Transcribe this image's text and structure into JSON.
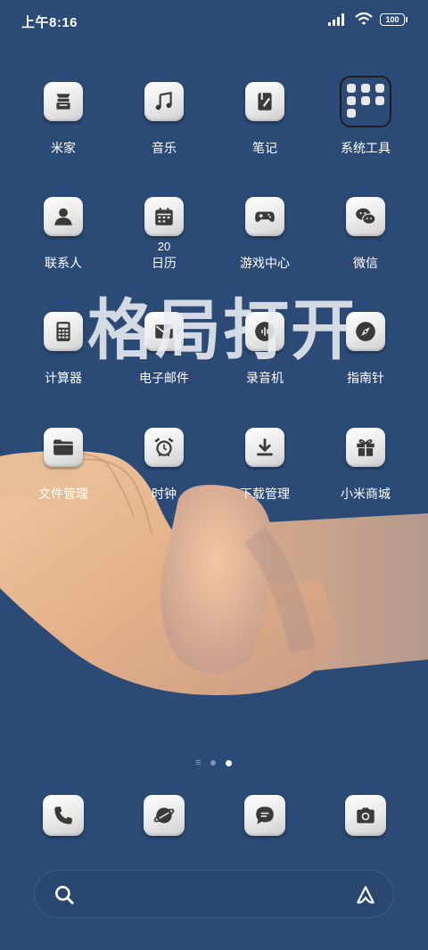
{
  "status_bar": {
    "time": "上午8:16",
    "battery": "100",
    "icons": [
      "signal-icon",
      "wifi-icon",
      "battery-icon"
    ]
  },
  "apps": [
    {
      "label": "米家",
      "icon": "mijia-icon"
    },
    {
      "label": "音乐",
      "icon": "music-icon"
    },
    {
      "label": "笔记",
      "icon": "notes-icon"
    },
    {
      "label": "系统工具",
      "icon": "folder-icon"
    },
    {
      "label": "联系人",
      "icon": "contacts-icon"
    },
    {
      "label": "日历",
      "icon": "calendar-icon",
      "date": "20"
    },
    {
      "label": "游戏中心",
      "icon": "gamepad-icon"
    },
    {
      "label": "微信",
      "icon": "wechat-icon"
    },
    {
      "label": "计算器",
      "icon": "calculator-icon"
    },
    {
      "label": "电子邮件",
      "icon": "mail-icon"
    },
    {
      "label": "录音机",
      "icon": "recorder-icon"
    },
    {
      "label": "指南针",
      "icon": "compass-icon"
    },
    {
      "label": "文件管理",
      "icon": "file-manager-icon"
    },
    {
      "label": "时钟",
      "icon": "clock-icon"
    },
    {
      "label": "下载管理",
      "icon": "download-icon"
    },
    {
      "label": "小米商城",
      "icon": "gift-icon"
    }
  ],
  "overlay_text": "格局打开",
  "page_indicator": {
    "pages": 2,
    "current": 2
  },
  "dock": [
    {
      "icon": "phone-icon"
    },
    {
      "icon": "browser-icon"
    },
    {
      "icon": "messages-icon"
    },
    {
      "icon": "camera-icon"
    }
  ],
  "search": {
    "placeholder": ""
  },
  "colors": {
    "background": "#2b4a75",
    "tile": "#ececec",
    "glyph": "#3a3a3a"
  }
}
